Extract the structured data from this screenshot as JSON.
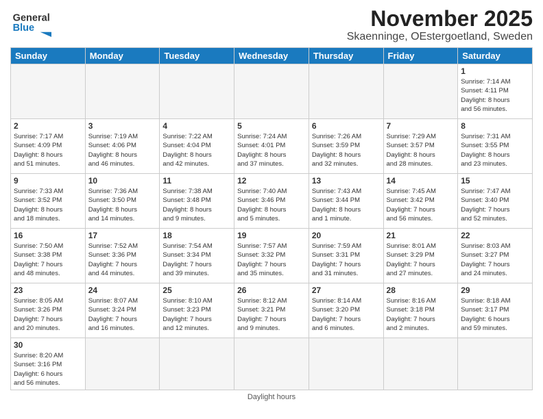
{
  "logo": {
    "general": "General",
    "blue": "Blue"
  },
  "title": "November 2025",
  "subtitle": "Skaenninge, OEstergoetland, Sweden",
  "days_of_week": [
    "Sunday",
    "Monday",
    "Tuesday",
    "Wednesday",
    "Thursday",
    "Friday",
    "Saturday"
  ],
  "weeks": [
    [
      {
        "day": "",
        "info": ""
      },
      {
        "day": "",
        "info": ""
      },
      {
        "day": "",
        "info": ""
      },
      {
        "day": "",
        "info": ""
      },
      {
        "day": "",
        "info": ""
      },
      {
        "day": "",
        "info": ""
      },
      {
        "day": "1",
        "info": "Sunrise: 7:14 AM\nSunset: 4:11 PM\nDaylight: 8 hours\nand 56 minutes."
      }
    ],
    [
      {
        "day": "2",
        "info": "Sunrise: 7:17 AM\nSunset: 4:09 PM\nDaylight: 8 hours\nand 51 minutes."
      },
      {
        "day": "3",
        "info": "Sunrise: 7:19 AM\nSunset: 4:06 PM\nDaylight: 8 hours\nand 46 minutes."
      },
      {
        "day": "4",
        "info": "Sunrise: 7:22 AM\nSunset: 4:04 PM\nDaylight: 8 hours\nand 42 minutes."
      },
      {
        "day": "5",
        "info": "Sunrise: 7:24 AM\nSunset: 4:01 PM\nDaylight: 8 hours\nand 37 minutes."
      },
      {
        "day": "6",
        "info": "Sunrise: 7:26 AM\nSunset: 3:59 PM\nDaylight: 8 hours\nand 32 minutes."
      },
      {
        "day": "7",
        "info": "Sunrise: 7:29 AM\nSunset: 3:57 PM\nDaylight: 8 hours\nand 28 minutes."
      },
      {
        "day": "8",
        "info": "Sunrise: 7:31 AM\nSunset: 3:55 PM\nDaylight: 8 hours\nand 23 minutes."
      }
    ],
    [
      {
        "day": "9",
        "info": "Sunrise: 7:33 AM\nSunset: 3:52 PM\nDaylight: 8 hours\nand 18 minutes."
      },
      {
        "day": "10",
        "info": "Sunrise: 7:36 AM\nSunset: 3:50 PM\nDaylight: 8 hours\nand 14 minutes."
      },
      {
        "day": "11",
        "info": "Sunrise: 7:38 AM\nSunset: 3:48 PM\nDaylight: 8 hours\nand 9 minutes."
      },
      {
        "day": "12",
        "info": "Sunrise: 7:40 AM\nSunset: 3:46 PM\nDaylight: 8 hours\nand 5 minutes."
      },
      {
        "day": "13",
        "info": "Sunrise: 7:43 AM\nSunset: 3:44 PM\nDaylight: 8 hours\nand 1 minute."
      },
      {
        "day": "14",
        "info": "Sunrise: 7:45 AM\nSunset: 3:42 PM\nDaylight: 7 hours\nand 56 minutes."
      },
      {
        "day": "15",
        "info": "Sunrise: 7:47 AM\nSunset: 3:40 PM\nDaylight: 7 hours\nand 52 minutes."
      }
    ],
    [
      {
        "day": "16",
        "info": "Sunrise: 7:50 AM\nSunset: 3:38 PM\nDaylight: 7 hours\nand 48 minutes."
      },
      {
        "day": "17",
        "info": "Sunrise: 7:52 AM\nSunset: 3:36 PM\nDaylight: 7 hours\nand 44 minutes."
      },
      {
        "day": "18",
        "info": "Sunrise: 7:54 AM\nSunset: 3:34 PM\nDaylight: 7 hours\nand 39 minutes."
      },
      {
        "day": "19",
        "info": "Sunrise: 7:57 AM\nSunset: 3:32 PM\nDaylight: 7 hours\nand 35 minutes."
      },
      {
        "day": "20",
        "info": "Sunrise: 7:59 AM\nSunset: 3:31 PM\nDaylight: 7 hours\nand 31 minutes."
      },
      {
        "day": "21",
        "info": "Sunrise: 8:01 AM\nSunset: 3:29 PM\nDaylight: 7 hours\nand 27 minutes."
      },
      {
        "day": "22",
        "info": "Sunrise: 8:03 AM\nSunset: 3:27 PM\nDaylight: 7 hours\nand 24 minutes."
      }
    ],
    [
      {
        "day": "23",
        "info": "Sunrise: 8:05 AM\nSunset: 3:26 PM\nDaylight: 7 hours\nand 20 minutes."
      },
      {
        "day": "24",
        "info": "Sunrise: 8:07 AM\nSunset: 3:24 PM\nDaylight: 7 hours\nand 16 minutes."
      },
      {
        "day": "25",
        "info": "Sunrise: 8:10 AM\nSunset: 3:23 PM\nDaylight: 7 hours\nand 12 minutes."
      },
      {
        "day": "26",
        "info": "Sunrise: 8:12 AM\nSunset: 3:21 PM\nDaylight: 7 hours\nand 9 minutes."
      },
      {
        "day": "27",
        "info": "Sunrise: 8:14 AM\nSunset: 3:20 PM\nDaylight: 7 hours\nand 6 minutes."
      },
      {
        "day": "28",
        "info": "Sunrise: 8:16 AM\nSunset: 3:18 PM\nDaylight: 7 hours\nand 2 minutes."
      },
      {
        "day": "29",
        "info": "Sunrise: 8:18 AM\nSunset: 3:17 PM\nDaylight: 6 hours\nand 59 minutes."
      }
    ],
    [
      {
        "day": "30",
        "info": "Sunrise: 8:20 AM\nSunset: 3:16 PM\nDaylight: 6 hours\nand 56 minutes."
      },
      {
        "day": "",
        "info": ""
      },
      {
        "day": "",
        "info": ""
      },
      {
        "day": "",
        "info": ""
      },
      {
        "day": "",
        "info": ""
      },
      {
        "day": "",
        "info": ""
      },
      {
        "day": "",
        "info": ""
      }
    ]
  ],
  "footer": "Daylight hours"
}
